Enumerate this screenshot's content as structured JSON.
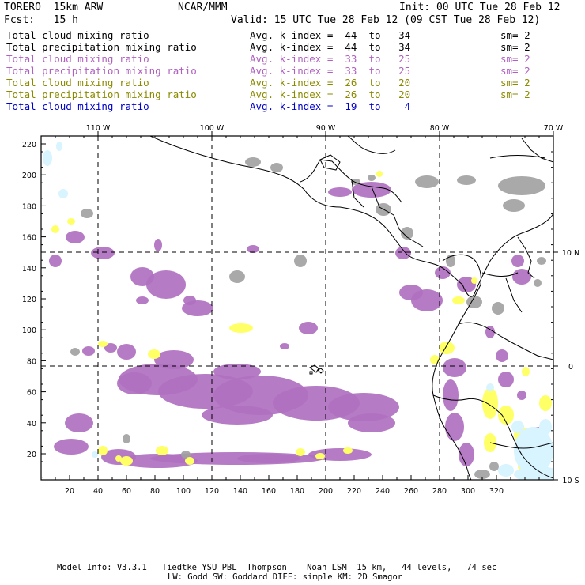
{
  "header": {
    "model": "TORERO  15km ARW",
    "org": "NCAR/MMM",
    "init": "Init: 00 UTC Tue 28 Feb 12",
    "fcst": "Fcst:   15 h",
    "valid": "Valid: 15 UTC Tue 28 Feb 12 (09 CST Tue 28 Feb 12)"
  },
  "legend": [
    {
      "field": "Total cloud mixing ratio",
      "range": "Avg. k-index =  44  to   34",
      "sm": "sm= 2",
      "color": "#000000"
    },
    {
      "field": "Total precipitation mixing ratio",
      "range": "Avg. k-index =  44  to   34",
      "sm": "sm= 2",
      "color": "#000000"
    },
    {
      "field": "Total cloud mixing ratio",
      "range": "Avg. k-index =  33  to   25",
      "sm": "sm= 2",
      "color": "#b060c0"
    },
    {
      "field": "Total precipitation mixing ratio",
      "range": "Avg. k-index =  33  to   25",
      "sm": "sm= 2",
      "color": "#b060c0"
    },
    {
      "field": "Total cloud mixing ratio",
      "range": "Avg. k-index =  26  to   20",
      "sm": "sm= 2",
      "color": "#8a8a00"
    },
    {
      "field": "Total precipitation mixing ratio",
      "range": "Avg. k-index =  26  to   20",
      "sm": "sm= 2",
      "color": "#8a8a00"
    },
    {
      "field": "Total cloud mixing ratio",
      "range": "Avg. k-index =  19  to    4",
      "sm": "",
      "color": "#0000cc"
    }
  ],
  "map": {
    "lon_labels": [
      "110 W",
      "100 W",
      "90 W",
      "80 W",
      "70 W"
    ],
    "lat_labels": [
      "10 N",
      "0",
      "10 S"
    ],
    "x_ticks": [
      "20",
      "40",
      "60",
      "80",
      "100",
      "120",
      "140",
      "160",
      "180",
      "200",
      "220",
      "240",
      "260",
      "280",
      "300",
      "320"
    ],
    "y_ticks": [
      "220",
      "200",
      "180",
      "160",
      "140",
      "120",
      "100",
      "80",
      "60",
      "40",
      "20"
    ],
    "colors": {
      "gray": "#a0a0a0",
      "purple": "#b070c0",
      "yellow": "#ffff66",
      "cyan": "#d8f4ff"
    }
  },
  "footer": {
    "line1": "Model Info: V3.3.1   Tiedtke YSU PBL  Thompson    Noah LSM  15 km,   44 levels,   74 sec",
    "line2": "LW: Godd SW: Goddard DIFF: simple KM: 2D Smagor"
  }
}
